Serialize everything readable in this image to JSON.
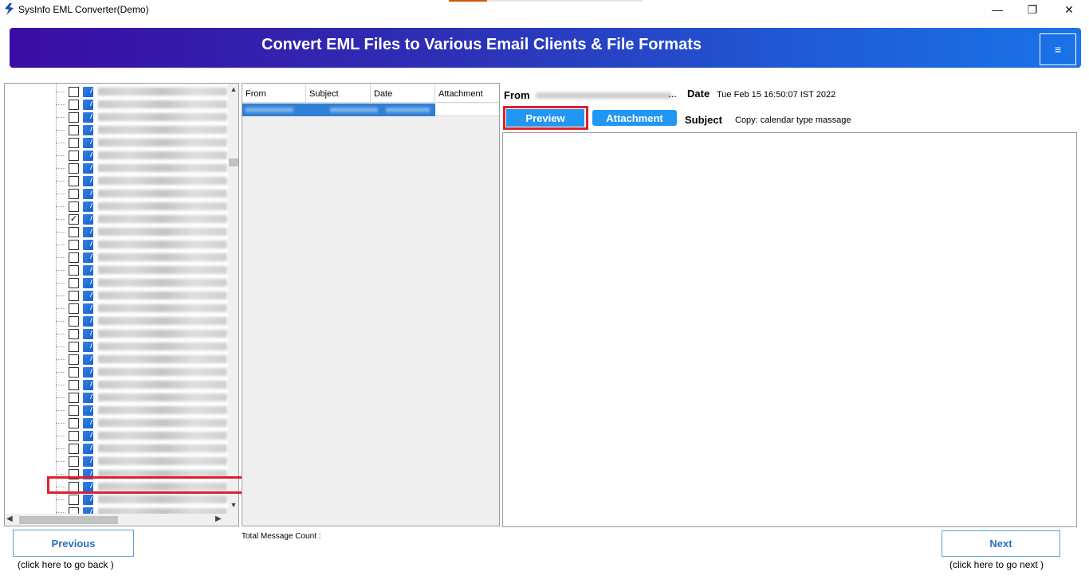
{
  "window": {
    "title": "SysInfo EML Converter(Demo)",
    "minimize_glyph": "—",
    "restore_glyph": "❐",
    "close_glyph": "✕"
  },
  "banner": {
    "title": "Convert EML Files to Various Email Clients & File Formats",
    "menu_glyph": "≡"
  },
  "tree": {
    "row_count": 34,
    "checked_row_index": 10,
    "check_glyph": "✓",
    "scroll_up_glyph": "▲",
    "scroll_down_glyph": "▼",
    "scroll_left_glyph": "◀",
    "scroll_right_glyph": "▶"
  },
  "message_list": {
    "columns": [
      "From",
      "Subject",
      "Date",
      "Attachment"
    ]
  },
  "preview": {
    "from_label": "From",
    "from_ellipsis": "...",
    "date_label": "Date",
    "date_value": "Tue Feb 15 16:50:07 IST 2022",
    "preview_label": "Preview",
    "attachment_label": "Attachment",
    "subject_label": "Subject",
    "subject_value": "Copy: calendar type massage"
  },
  "footer": {
    "previous_label": "Previous",
    "previous_hint": "(click here to  go back )",
    "total_count_label": "Total Message Count :",
    "next_label": "Next",
    "next_hint": "(click here to  go next )"
  },
  "colors": {
    "banner_start": "#3a0ca3",
    "banner_end": "#1a73e8",
    "button_blue": "#2196f3",
    "highlight_red": "#e0202a",
    "selection_blue": "#2f7fd7"
  }
}
